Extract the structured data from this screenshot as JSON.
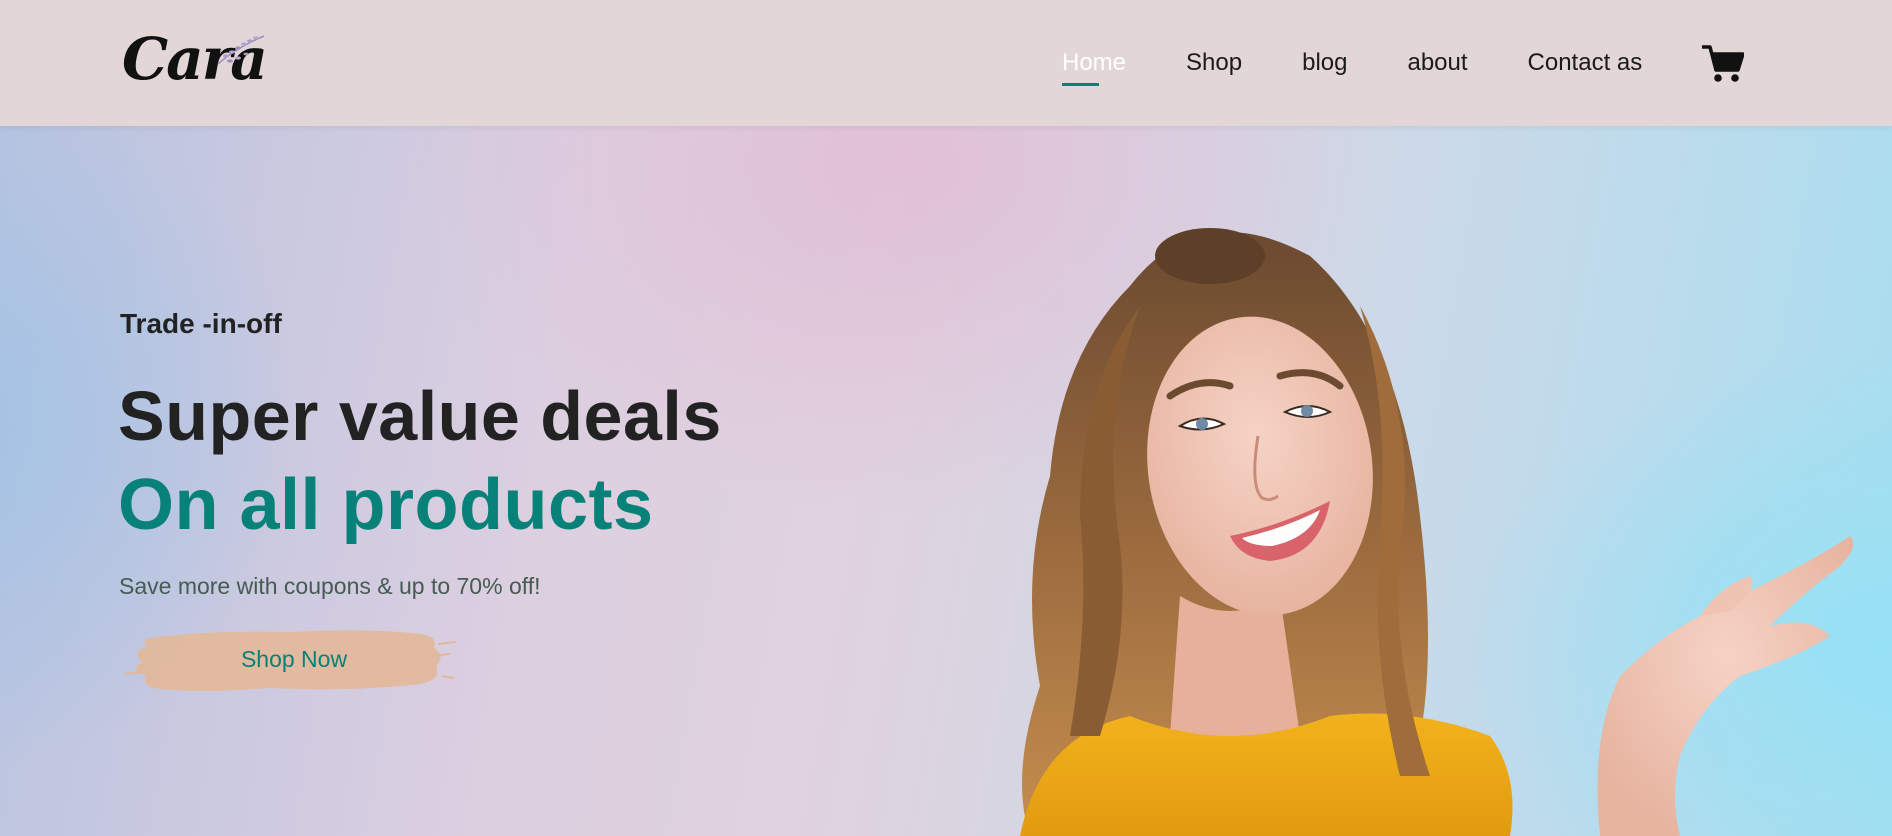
{
  "brand": {
    "logo_text": "Cara"
  },
  "nav": {
    "items": [
      {
        "label": "Home",
        "active": true
      },
      {
        "label": "Shop",
        "active": false
      },
      {
        "label": "blog",
        "active": false
      },
      {
        "label": "about",
        "active": false
      },
      {
        "label": "Contact as",
        "active": false
      }
    ],
    "cart_icon": "shopping-cart-icon"
  },
  "hero": {
    "eyebrow": "Trade -in-off",
    "headline": "Super value deals",
    "headline_accent": "On all products",
    "subtext": "Save more with coupons & up to 70% off!",
    "cta_label": "Shop Now"
  },
  "colors": {
    "accent": "#088178",
    "header_bg": "#e3d6d6",
    "button_bg": "#e3b89a",
    "text_dark": "#222222"
  }
}
